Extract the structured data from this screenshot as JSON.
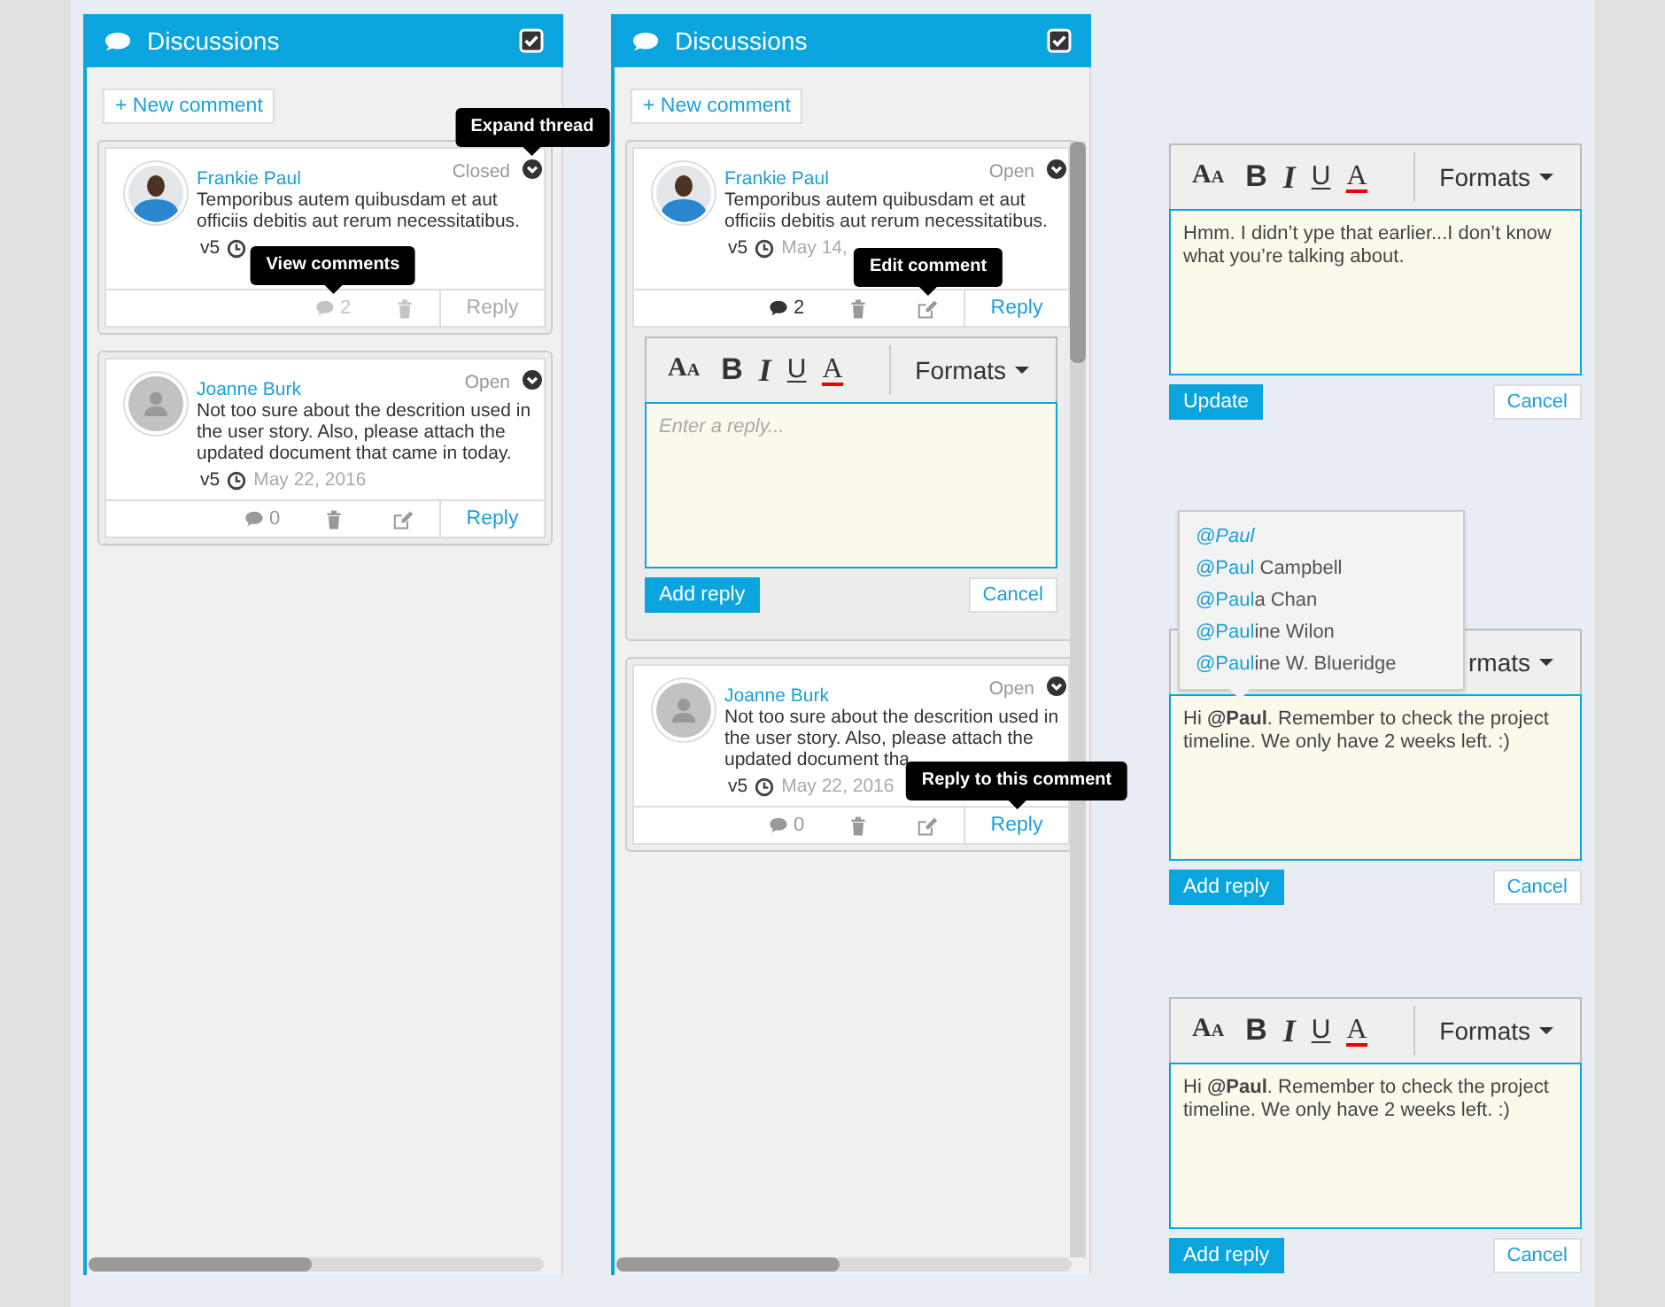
{
  "panels": [
    {
      "title": "Discussions",
      "checked": true,
      "new_comment": "+ New comment",
      "comments": [
        {
          "author": "Frankie Paul",
          "avatar": {
            "kind": "photo"
          },
          "status": "Closed",
          "body": "Temporibus autem quibusdam et aut officiis debitis aut rerum necessitatibus.",
          "version": "v5",
          "comment_count": "2",
          "editable": false,
          "disabled": true,
          "expanded": false,
          "reply": "Reply",
          "tooltips": [
            {
              "kind": "expand",
              "text": "Expand thread"
            },
            {
              "kind": "comments",
              "text": "View comments"
            }
          ]
        },
        {
          "author": "Joanne Burk",
          "avatar": {
            "kind": "placeholder"
          },
          "status": "Open",
          "body": "Not too sure about the descrition used in the user story. Also, please attach the updated document that came in today.",
          "version": "v5",
          "date": "May 22, 2016",
          "comment_count": "0",
          "editable": true,
          "disabled": false,
          "expanded": false,
          "reply": "Reply"
        }
      ]
    },
    {
      "title": "Discussions",
      "checked": true,
      "new_comment": "+ New comment",
      "vertical_scrollbar": true,
      "comments": [
        {
          "author": "Frankie Paul",
          "avatar": {
            "kind": "photo"
          },
          "status": "Open",
          "body": "Temporibus autem quibusdam et aut officiis debitis aut rerum necessitatibus.",
          "version": "v5",
          "date": "May 14,",
          "comment_count": "2",
          "editable": true,
          "disabled": false,
          "expanded": true,
          "reply": "Reply",
          "tooltips": [
            {
              "kind": "edit",
              "text": "Edit comment"
            }
          ],
          "reply_box": {
            "toolbar": [
              {
                "kind": "size",
                "label": "AA"
              },
              {
                "kind": "bold",
                "label": "B"
              },
              {
                "kind": "italic",
                "label": "I"
              },
              {
                "kind": "underline",
                "label": "U"
              },
              {
                "kind": "color",
                "label": "A"
              }
            ],
            "formats": "Formats",
            "placeholder": "Enter a reply...",
            "submit": "Add reply",
            "cancel": "Cancel"
          }
        },
        {
          "author": "Joanne Burk",
          "avatar": {
            "kind": "placeholder"
          },
          "status": "Open",
          "body": "Not too sure about the descrition used in the user story. Also, please attach the updated document tha",
          "version": "v5",
          "date": "May 22, 2016",
          "comment_count": "0",
          "editable": true,
          "disabled": false,
          "expanded": false,
          "reply": "Reply",
          "tooltips": [
            {
              "kind": "reply",
              "text": "Reply to this comment"
            }
          ]
        }
      ]
    }
  ],
  "editors": [
    {
      "toolbar": [
        {
          "kind": "size",
          "label": "AA"
        },
        {
          "kind": "bold",
          "label": "B"
        },
        {
          "kind": "italic",
          "label": "I"
        },
        {
          "kind": "underline",
          "label": "U"
        },
        {
          "kind": "color",
          "label": "A"
        }
      ],
      "formats": "Formats",
      "value": "Hmm. I didn’t ype that earlier...I don’t know what you’re talking about.",
      "submit": "Update",
      "cancel": "Cancel"
    },
    {
      "formats": "rmats",
      "value": "Hi **@Paul**. Remember to check the project timeline. We only have 2 weeks left. :)",
      "submit": "Add reply",
      "cancel": "Cancel",
      "mentions": [
        {
          "match": "@Paul",
          "selected": true
        },
        {
          "match": "@Paul",
          "rest": " Campbell",
          "selected": false
        },
        {
          "match": "@Paul",
          "rest": "a Chan",
          "selected": false
        },
        {
          "match": "@Paul",
          "rest": "ine Wilon",
          "selected": false
        },
        {
          "match": "@Paul",
          "rest": "ine W. Blueridge",
          "selected": false
        }
      ]
    },
    {
      "toolbar": [
        {
          "kind": "size",
          "label": "AA"
        },
        {
          "kind": "bold",
          "label": "B"
        },
        {
          "kind": "italic",
          "label": "I"
        },
        {
          "kind": "underline",
          "label": "U"
        },
        {
          "kind": "color",
          "label": "A"
        }
      ],
      "formats": "Formats",
      "value": "Hi **@Paul**. Remember to check the project timeline. We only have 2 weeks left. :)",
      "submit": "Add reply",
      "cancel": "Cancel"
    }
  ]
}
